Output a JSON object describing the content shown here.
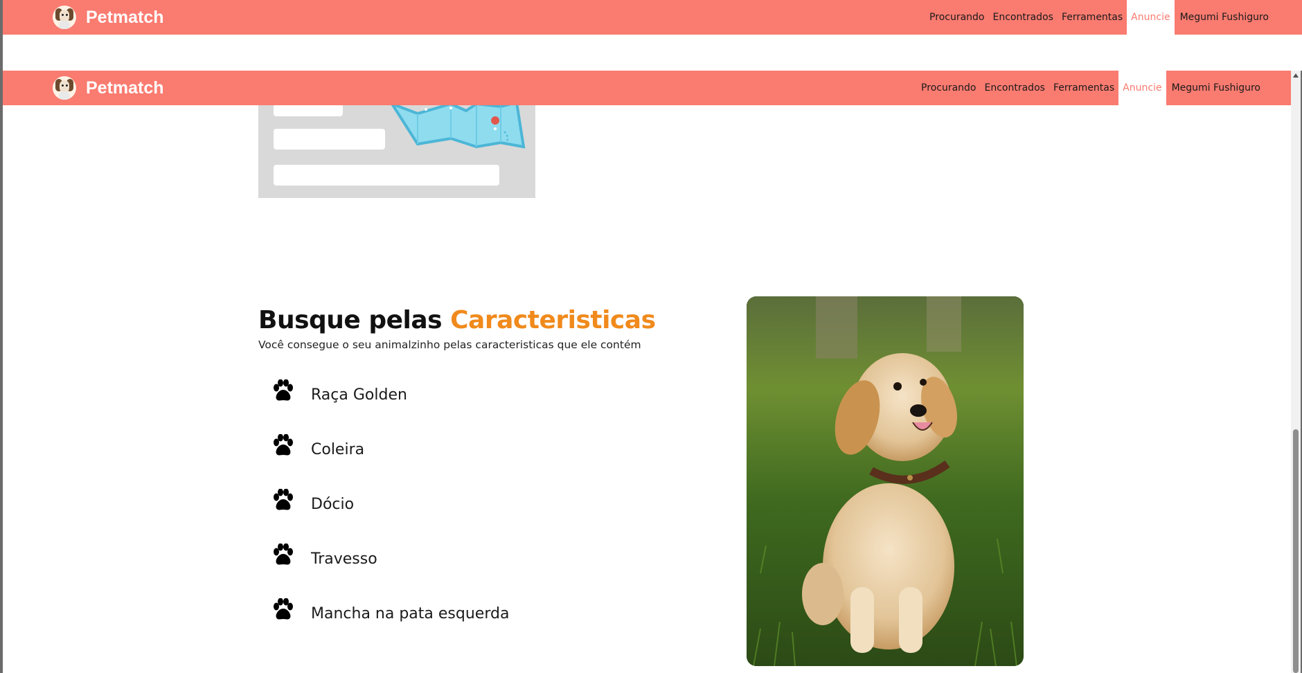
{
  "brand": {
    "name": "Petmatch"
  },
  "nav": {
    "items": [
      "Procurando",
      "Encontrados",
      "Ferramentas",
      "Anuncie"
    ],
    "active": "Anuncie",
    "user": "Megumi Fushiguro"
  },
  "features": {
    "title_prefix": "Busque pelas",
    "title_accent": "Caracteristicas",
    "subtitle": "Você consegue o seu animalzinho pelas caracteristicas que ele contém",
    "items": [
      "Raça Golden",
      "Coleira",
      "Dócio",
      "Travesso",
      "Mancha na pata esquerda"
    ]
  },
  "colors": {
    "navbar": "#fa7b70",
    "accent": "#f08a1c",
    "active_link": "#fa7b70"
  },
  "icons": {
    "feature_bullet": "paw-icon",
    "logo": "dog-logo-icon"
  }
}
